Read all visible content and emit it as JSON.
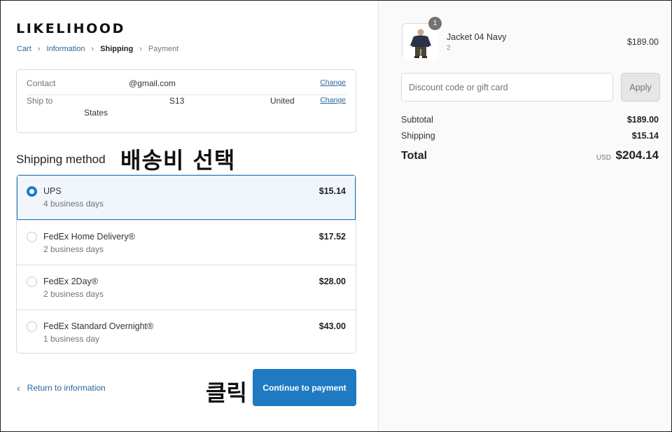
{
  "brand": {
    "logo_text": "LIKELIHOOD"
  },
  "breadcrumb": [
    {
      "label": "Cart",
      "state": "link"
    },
    {
      "label": "Information",
      "state": "link"
    },
    {
      "label": "Shipping",
      "state": "current"
    },
    {
      "label": "Payment",
      "state": "disabled"
    }
  ],
  "breadcrumb_separator_icon": "chevron-right-icon",
  "contact": {
    "label": "Contact",
    "value": "@gmail.com",
    "change_label": "Change"
  },
  "ship_to": {
    "label": "Ship to",
    "value_part1": "S13",
    "value_part2": "United",
    "value_part3": "States",
    "change_label": "Change"
  },
  "shipping_method": {
    "title": "Shipping method",
    "annotation": "배송비 선택",
    "options": [
      {
        "name": "UPS",
        "days": "4 business days",
        "price": "$15.14",
        "selected": true
      },
      {
        "name": "FedEx Home Delivery®",
        "days": "2 business days",
        "price": "$17.52",
        "selected": false
      },
      {
        "name": "FedEx 2Day®",
        "days": "2 business days",
        "price": "$28.00",
        "selected": false
      },
      {
        "name": "FedEx Standard Overnight®",
        "days": "1 business day",
        "price": "$43.00",
        "selected": false
      }
    ]
  },
  "footer": {
    "return_label": "Return to information",
    "click_annotation": "클릭",
    "continue_label": "Continue to payment"
  },
  "order": {
    "item": {
      "name": "Jacket 04 Navy",
      "variant": "2",
      "price": "$189.00",
      "quantity": "1"
    },
    "discount": {
      "placeholder": "Discount code or gift card",
      "apply_label": "Apply"
    },
    "subtotal_label": "Subtotal",
    "subtotal_value": "$189.00",
    "shipping_label": "Shipping",
    "shipping_value": "$15.14",
    "total_label": "Total",
    "currency": "USD",
    "total_value": "$204.14"
  },
  "colors": {
    "accent": "#1f7ac1",
    "link": "#2a6496",
    "selected_bg": "#f0f6fc",
    "sidebar_bg": "#fafafa"
  }
}
